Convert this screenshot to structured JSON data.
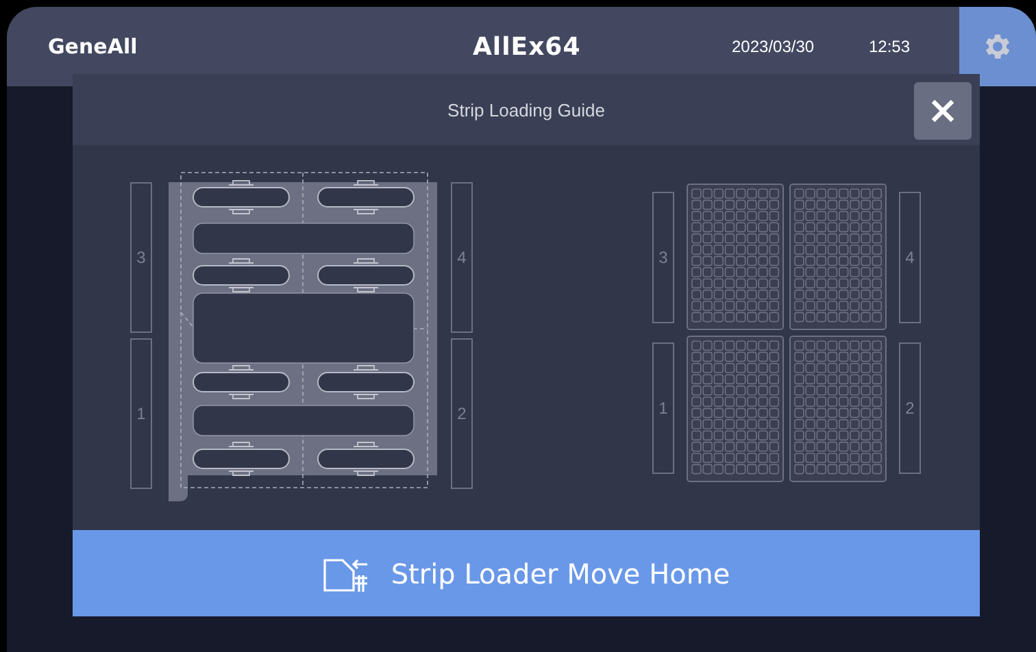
{
  "header": {
    "brand": "GeneAll",
    "title": "AllEx64",
    "date": "2023/03/30",
    "time": "12:53"
  },
  "dialog": {
    "title": "Strip Loading Guide",
    "diagrams": [
      {
        "kind": "strip",
        "left_slots": [
          "3",
          "1"
        ],
        "right_slots": [
          "4",
          "2"
        ]
      },
      {
        "kind": "plate",
        "left_slots": [
          "3",
          "1"
        ],
        "right_slots": [
          "4",
          "2"
        ]
      }
    ],
    "action_button": "Strip Loader Move Home"
  }
}
